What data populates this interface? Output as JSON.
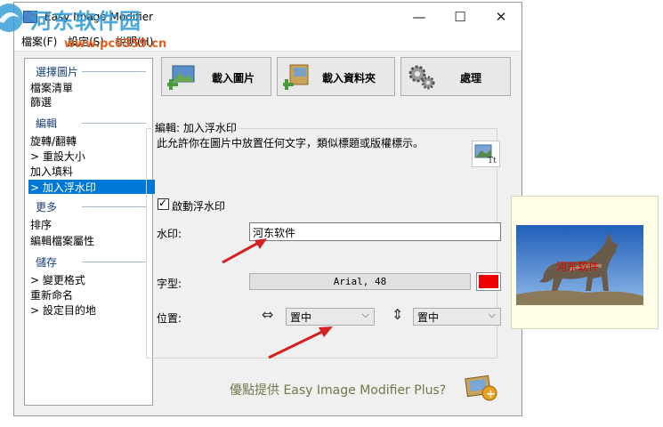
{
  "window": {
    "title": "Easy Image Modifier",
    "minimize": "—",
    "maximize": "☐",
    "close": "✕"
  },
  "watermark": {
    "text": "河东软件园",
    "url": "www.pc0359.cn"
  },
  "menu": [
    {
      "label": "檔案(F)"
    },
    {
      "label": "設定(S)"
    },
    {
      "label": "說明(H)"
    }
  ],
  "sidebar": {
    "sections": [
      {
        "title": "選擇圖片",
        "items": [
          "檔案清單",
          "篩選"
        ]
      },
      {
        "title": "編輯",
        "items": [
          "旋轉/翻轉",
          "> 重設大小",
          "加入填料",
          "> 加入浮水印"
        ]
      },
      {
        "title": "更多",
        "items": [
          "排序",
          "編輯檔案屬性"
        ]
      },
      {
        "title": "儲存",
        "items": [
          "> 變更格式",
          "重新命名",
          "> 設定目的地"
        ]
      }
    ],
    "selected": "> 加入浮水印"
  },
  "toolbar": {
    "load_images": "載入圖片",
    "load_folder": "載入資料夾",
    "process": "處理"
  },
  "panel": {
    "group_title": "編輯: 加入浮水印",
    "description": "此允許你在圖片中放置任何文字，類似標題或版權標示。",
    "enable_label": "啟動浮水印",
    "enable_checked": true,
    "watermark_label": "水印:",
    "watermark_value": "河东软件",
    "font_label": "字型:",
    "font_value": "Arial, 48",
    "color": "#ee0000",
    "position_label": "位置:",
    "h_align": "置中",
    "v_align": "置中"
  },
  "promo": {
    "text": "優點提供 Easy Image Modifier Plus?"
  },
  "preview": {
    "watermark_text": "河东软件"
  }
}
